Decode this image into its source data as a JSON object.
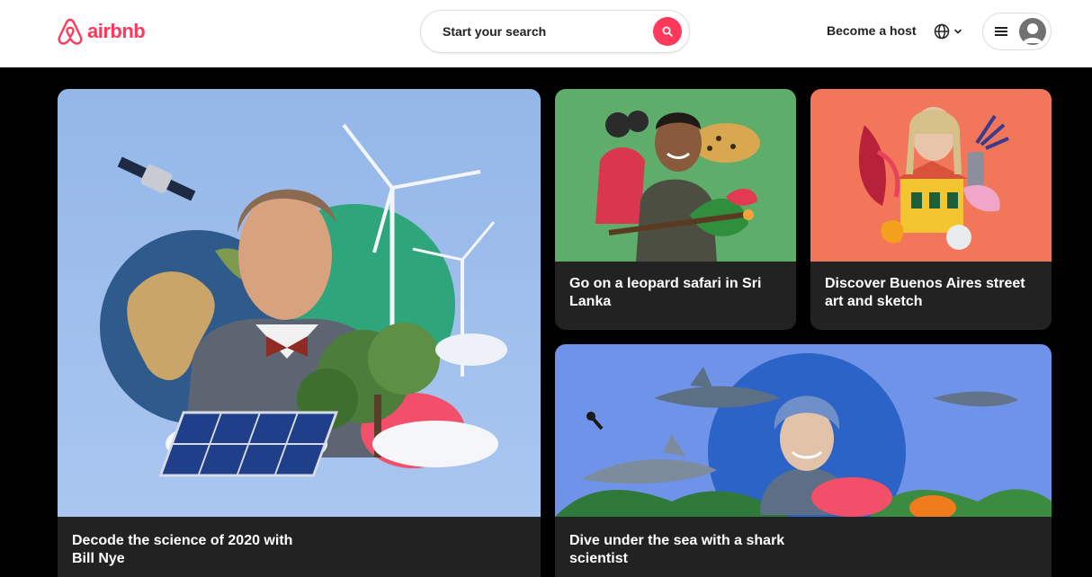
{
  "header": {
    "logo_text": "airbnb",
    "search_placeholder": "Start your search",
    "host_link": "Become a host"
  },
  "colors": {
    "brand": "#FF385C",
    "card_background": "#222222",
    "page_background": "#000000"
  },
  "cards": [
    {
      "caption": "Decode the science of 2020 with Bill Nye",
      "image_icon": "bill-nye-collage"
    },
    {
      "caption": "Go on a leopard safari in Sri Lanka",
      "image_icon": "leopard-safari-collage"
    },
    {
      "caption": "Discover Buenos Aires street art and sketch",
      "image_icon": "street-art-collage"
    },
    {
      "caption": "Dive under the sea with a shark scientist",
      "image_icon": "shark-scientist-collage"
    }
  ]
}
